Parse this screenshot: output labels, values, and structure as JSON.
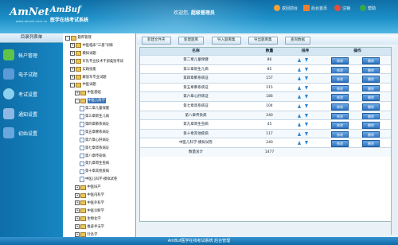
{
  "header": {
    "logo_text": "AmNet",
    "logo_sub": "www.amnet.com.cn",
    "app_name": "AmBuf",
    "app_title": "医学在线考试系统",
    "welcome_prefix": "欢迎您,",
    "welcome_user": "超级管理员",
    "nav": [
      {
        "label": "返回前台",
        "icon": "home-icon",
        "color": "#f2a23a"
      },
      {
        "label": "后台首页",
        "icon": "house-icon",
        "color": "#f07f2d"
      },
      {
        "label": "注销",
        "icon": "logout-icon",
        "color": "#e74c3c"
      },
      {
        "label": "帮助",
        "icon": "help-icon",
        "color": "#3aa64a"
      }
    ]
  },
  "sidebar": {
    "title": "目录列表单",
    "items": [
      {
        "label": "帐户管理",
        "icon": "account-icon",
        "color": "#5fc447"
      },
      {
        "label": "电子试题",
        "icon": "exam-icon",
        "color": "#5b9ad6"
      },
      {
        "label": "考试设置",
        "icon": "settings-icon",
        "color": "#8cd0f0"
      },
      {
        "label": "通知设置",
        "icon": "notice-icon",
        "color": "#8fb7e3"
      },
      {
        "label": "初始设置",
        "icon": "init-icon",
        "color": "#6aa7de"
      }
    ]
  },
  "tree": [
    {
      "label": "题库管理",
      "type": "folder",
      "exp": "-",
      "level": 0
    },
    {
      "label": "中医临床“三基”训练",
      "type": "folder",
      "exp": "+",
      "level": 1
    },
    {
      "label": "模拟试题",
      "type": "folder",
      "exp": "+",
      "level": 1
    },
    {
      "label": "军队专业技术干部类别考试",
      "type": "folder",
      "exp": "+",
      "level": 1
    },
    {
      "label": "实践技能",
      "type": "folder",
      "exp": "+",
      "level": 1
    },
    {
      "label": "解放军专业试题",
      "type": "folder",
      "exp": "+",
      "level": 1
    },
    {
      "label": "中医试题",
      "type": "folder",
      "exp": "-",
      "level": 1
    },
    {
      "label": "中医基础",
      "type": "folder",
      "exp": "+",
      "level": 2
    },
    {
      "label": "中医儿科学",
      "type": "folder",
      "exp": "-",
      "level": 2,
      "selected": true
    },
    {
      "label": "第二章儿童保健",
      "type": "doc",
      "exp": "",
      "level": 3
    },
    {
      "label": "第三章新生儿病",
      "type": "doc",
      "exp": "",
      "level": 3
    },
    {
      "label": "第四章肺系病证",
      "type": "doc",
      "exp": "",
      "level": 3
    },
    {
      "label": "第五章脾系病证",
      "type": "doc",
      "exp": "",
      "level": 3
    },
    {
      "label": "第六章心肝病证",
      "type": "doc",
      "exp": "",
      "level": 3
    },
    {
      "label": "第七章肾系病证",
      "type": "doc",
      "exp": "",
      "level": 3
    },
    {
      "label": "第八章传染病",
      "type": "doc",
      "exp": "",
      "level": 3
    },
    {
      "label": "第九章寄生虫病",
      "type": "doc",
      "exp": "",
      "level": 3
    },
    {
      "label": "第十章其他疾病",
      "type": "doc",
      "exp": "",
      "level": 3
    },
    {
      "label": "中医儿科学-模拟试卷",
      "type": "doc",
      "exp": "",
      "level": 3
    },
    {
      "label": "中医妇产",
      "type": "folder",
      "exp": "+",
      "level": 2
    },
    {
      "label": "中医内科学",
      "type": "folder",
      "exp": "+",
      "level": 2
    },
    {
      "label": "中医外科学",
      "type": "folder",
      "exp": "+",
      "level": 2
    },
    {
      "label": "中医诊断学",
      "type": "folder",
      "exp": "+",
      "level": 2
    },
    {
      "label": "生物化学",
      "type": "folder",
      "exp": "+",
      "level": 2
    },
    {
      "label": "推拿手法学",
      "type": "folder",
      "exp": "+",
      "level": 2
    },
    {
      "label": "针灸学",
      "type": "folder",
      "exp": "+",
      "level": 2
    }
  ],
  "toolbar": {
    "buttons": [
      "新建文件夹",
      "新建题库",
      "导入题库集",
      "导出题库集",
      "查询数据"
    ]
  },
  "table": {
    "headers": [
      "名称",
      "数量",
      "排序",
      "操作"
    ],
    "rows": [
      {
        "name": "第二章儿童保健",
        "count": "86"
      },
      {
        "name": "第三章新生儿病",
        "count": "85"
      },
      {
        "name": "第四章肺系病证",
        "count": "157"
      },
      {
        "name": "第五章脾系病证",
        "count": "215"
      },
      {
        "name": "第六章心肝病证",
        "count": "186"
      },
      {
        "name": "第七章肾系病证",
        "count": "104"
      },
      {
        "name": "第八章传染病",
        "count": "240"
      },
      {
        "name": "第九章寄生虫病",
        "count": "45"
      },
      {
        "name": "第十章其他疾病",
        "count": "117"
      },
      {
        "name": "中医儿科学-模拟试卷",
        "count": "240"
      }
    ],
    "edit_label": "修改",
    "delete_label": "删除",
    "total_label": "数量总计",
    "total_value": "1477"
  },
  "footer": {
    "text": "AmBuf医学在线考试系统 后台管理"
  }
}
